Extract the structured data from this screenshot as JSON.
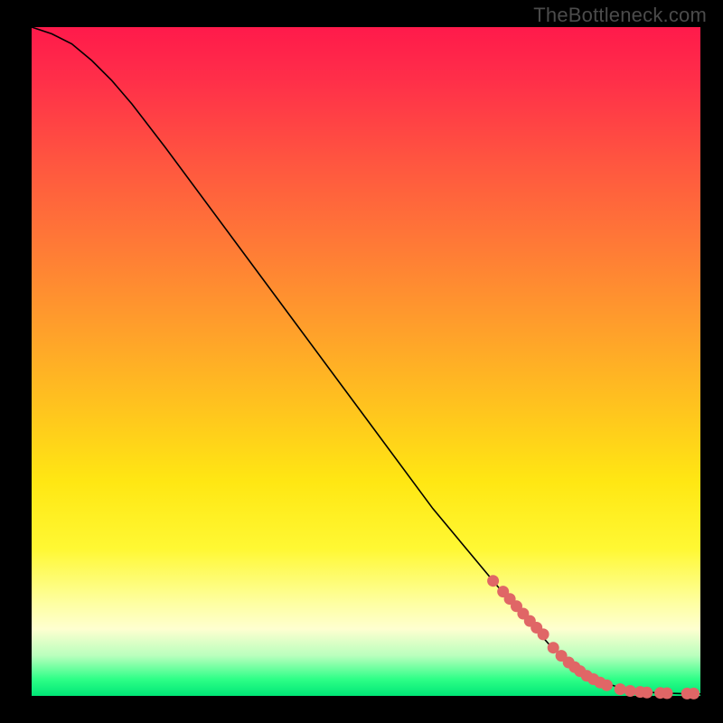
{
  "watermark": "TheBottleneck.com",
  "chart_data": {
    "type": "line",
    "title": "",
    "xlabel": "",
    "ylabel": "",
    "xlim": [
      0,
      100
    ],
    "ylim": [
      0,
      100
    ],
    "grid": false,
    "legend": false,
    "curve": {
      "x": [
        0,
        3,
        6,
        9,
        12,
        15,
        20,
        30,
        40,
        50,
        60,
        70,
        78,
        82,
        85,
        88,
        91,
        93,
        95,
        97,
        100
      ],
      "y": [
        100,
        99,
        97.5,
        95,
        92,
        88.5,
        82,
        68.5,
        55,
        41.5,
        28,
        16,
        7,
        4,
        2.2,
        1.2,
        0.7,
        0.5,
        0.4,
        0.35,
        0.3
      ]
    },
    "markers": {
      "x": [
        69,
        70.5,
        71.5,
        72.5,
        73.5,
        74.5,
        75.5,
        76.5,
        78,
        79.2,
        80.3,
        81.2,
        82,
        83,
        84,
        85,
        86,
        88,
        89.5,
        91,
        92,
        94,
        95,
        98,
        99
      ],
      "y": [
        17.2,
        15.6,
        14.5,
        13.4,
        12.3,
        11.2,
        10.2,
        9.2,
        7.2,
        6.0,
        5.0,
        4.3,
        3.7,
        3.0,
        2.5,
        2.0,
        1.6,
        1.0,
        0.75,
        0.6,
        0.5,
        0.45,
        0.4,
        0.35,
        0.35
      ]
    },
    "colors": {
      "curve": "#000000",
      "markers": "#e06666",
      "gradient_top": "#ff1a4b",
      "gradient_mid": "#ffe713",
      "gradient_bottom": "#00e676"
    }
  }
}
